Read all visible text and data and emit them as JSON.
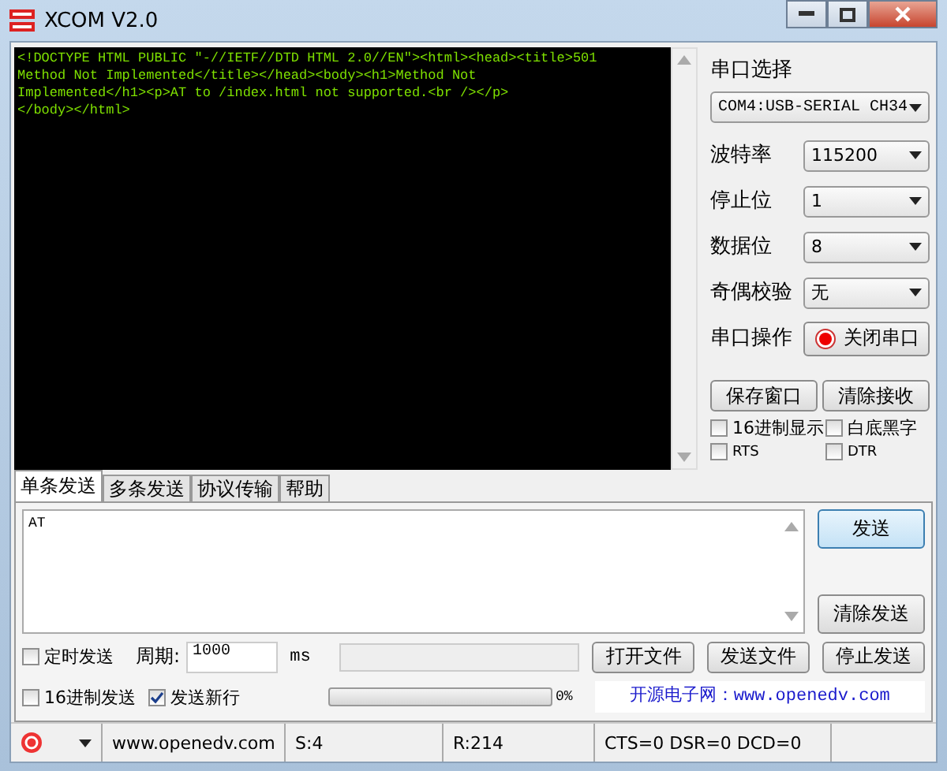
{
  "window": {
    "title": "XCOM V2.0"
  },
  "receive": {
    "lines": [
      "<!DOCTYPE HTML PUBLIC \"-//IETF//DTD HTML 2.0//EN\"><html><head><title>501",
      "Method Not Implemented</title></head><body><h1>Method Not",
      "Implemented</h1><p>AT to /index.html not supported.<br /></p>",
      "</body></html>"
    ]
  },
  "port_panel": {
    "port_label": "串口选择",
    "port_value": "COM4:USB-SERIAL CH34",
    "settings": [
      {
        "label": "波特率",
        "value": "115200"
      },
      {
        "label": "停止位",
        "value": "1"
      },
      {
        "label": "数据位",
        "value": "8"
      },
      {
        "label": "奇偶校验",
        "value": "无"
      }
    ],
    "operation": {
      "label": "串口操作",
      "button": "关闭串口",
      "on": true
    },
    "buttons": [
      "保存窗口",
      "清除接收"
    ],
    "checkboxes": [
      {
        "label": "16进制显示",
        "checked": false
      },
      {
        "label": "白底黑字",
        "checked": false
      },
      {
        "label": "RTS",
        "checked": false
      },
      {
        "label": "DTR",
        "checked": false
      }
    ]
  },
  "tabs": [
    {
      "label": "单条发送",
      "selected": true
    },
    {
      "label": "多条发送",
      "selected": false
    },
    {
      "label": "协议传输",
      "selected": false
    },
    {
      "label": "帮助",
      "selected": false
    }
  ],
  "send": {
    "value": "AT",
    "buttons": [
      "发送",
      "清除发送"
    ],
    "timed": {
      "label": "定时发送",
      "checked": false
    },
    "period_label": "周期:",
    "period_value": "1000",
    "unit": "ms",
    "file_buttons": [
      "打开文件",
      "发送文件",
      "停止发送"
    ],
    "hex": {
      "label": "16进制发送",
      "checked": false
    },
    "newline": {
      "label": "发送新行",
      "checked": true
    },
    "progress": {
      "level": 0,
      "reading": "0%"
    },
    "link": "开源电子网：www.openedv.com"
  },
  "status_bar": {
    "site": "www.openedv.com",
    "sent": "S:4",
    "received": "R:214",
    "lines": "CTS=0 DSR=0 DCD=0"
  }
}
